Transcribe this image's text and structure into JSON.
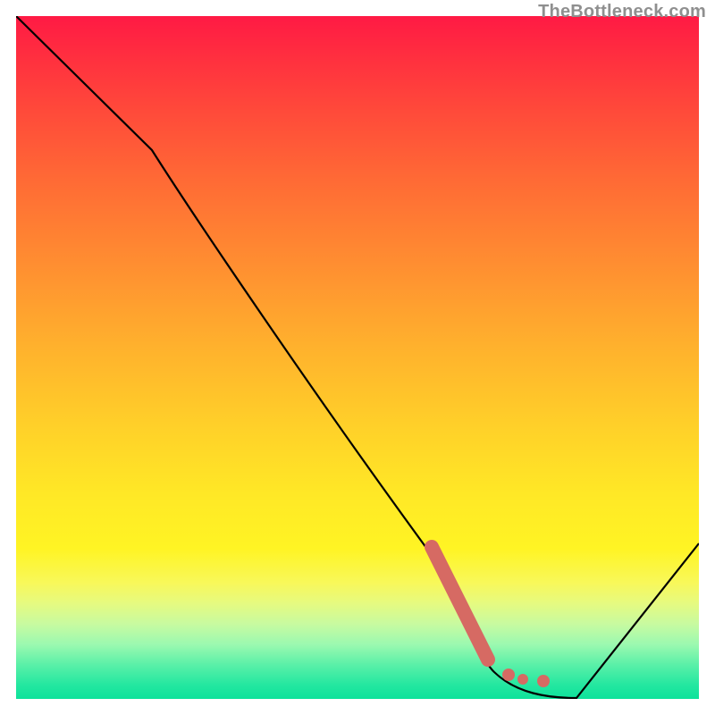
{
  "watermark": "TheBottleneck.com",
  "chart_data": {
    "type": "line",
    "title": "",
    "xlabel": "",
    "ylabel": "",
    "xlim": [
      0,
      100
    ],
    "ylim": [
      0,
      100
    ],
    "series": [
      {
        "name": "bottleneck-curve",
        "color": "#000000",
        "x": [
          0,
          20,
          63,
          70,
          78,
          82,
          100
        ],
        "y": [
          100,
          80,
          18,
          4,
          0,
          0,
          23
        ]
      },
      {
        "name": "highlight-segment",
        "color": "#d66a63",
        "x": [
          61,
          69,
          72,
          74,
          77
        ],
        "y": [
          22,
          6,
          4.5,
          3.5,
          3
        ]
      }
    ]
  }
}
